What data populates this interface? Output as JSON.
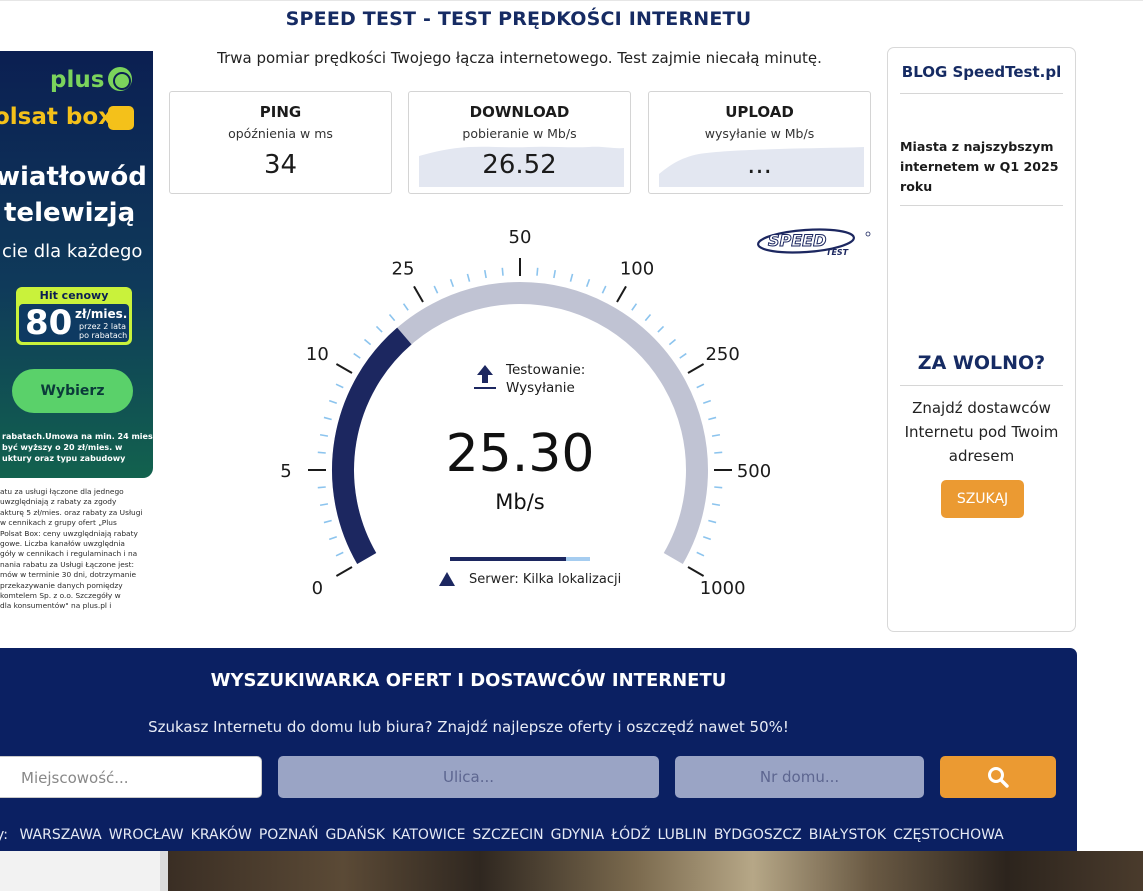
{
  "header": {
    "title": "SPEED TEST - TEST PRĘDKOŚCI INTERNETU"
  },
  "subtitle": "Trwa pomiar prędkości Twojego łącza internetowego. Test zajmie niecałą minutę.",
  "ad": {
    "brand1": "plus",
    "brand2": "olsat box",
    "line1": "wiatłowód",
    "line2": "telewizją",
    "line3": "cie dla każdego",
    "price_tag": "Hit cenowy",
    "price_num": "80",
    "price_unit": "zł/mies.",
    "price_sub1": "przez 2 lata",
    "price_sub2": "po rabatach",
    "cta": "Wybierz",
    "fine1": "rabatach.Umowa na min. 24 mies.",
    "fine2": "być wyższy o 20 zł/mies. w",
    "fine3": "uktury oraz typu zabudowy",
    "legal": [
      "atu za usługi łączone dla jednego",
      "uwzględniają z rabaty za zgody",
      "akturę 5 zł/mies. oraz rabaty za Usługi",
      "w cennikach z grupy ofert „Plus",
      "Polsat Box: ceny uwzględniają rabaty",
      "gowe. Liczba kanałów uwzględnia",
      "góły w cennikach i regulaminach i na",
      "nania rabatu za Usługi Łączone jest:",
      "mów w terminie 30 dni, dotrzymanie",
      "przekazywanie danych pomiędzy",
      "komtelem Sp. z o.o. Szczegóły w",
      "dla konsumentów\" na plus.pl i"
    ]
  },
  "stats": {
    "ping": {
      "title": "PING",
      "sub": "opóźnienia w ms",
      "value": "34"
    },
    "download": {
      "title": "DOWNLOAD",
      "sub": "pobieranie w Mb/s",
      "value": "26.52"
    },
    "upload": {
      "title": "UPLOAD",
      "sub": "wysyłanie w Mb/s",
      "value": "..."
    }
  },
  "gauge": {
    "status_line1": "Testowanie:",
    "status_line2": "Wysyłanie",
    "value": "25.30",
    "unit": "Mb/s",
    "ticks": [
      "0",
      "5",
      "10",
      "25",
      "50",
      "100",
      "250",
      "500",
      "1000"
    ],
    "fraction": 0.33,
    "progress": 0.83,
    "server": "Serwer: Kilka lokalizacji"
  },
  "logo": {
    "top": "SPEED",
    "bottom": "TEST"
  },
  "sidebar": {
    "blog_title": "BLOG SpeedTest.pl",
    "blog_item": "Miasta z najszybszym internetem w Q1 2025 roku",
    "slow_title": "ZA WOLNO?",
    "slow_text": "Znajdź dostawców Internetu pod Twoim adresem",
    "search_label": "SZUKAJ"
  },
  "band": {
    "title": "WYSZUKIWARKA OFERT I DOSTAWCÓW INTERNETU",
    "subtitle": "Szukasz Internetu do domu lub biura? Znajdź najlepsze oferty i oszczędź nawet 50%!",
    "city_placeholder": "Miejscowość...",
    "street_placeholder": "Ulica...",
    "number_placeholder": "Nr domu...",
    "cities_label": "y:",
    "cities": [
      "WARSZAWA",
      "WROCŁAW",
      "KRAKÓW",
      "POZNAŃ",
      "GDAŃSK",
      "KATOWICE",
      "SZCZECIN",
      "GDYNIA",
      "ŁÓDŹ",
      "LUBLIN",
      "BYDGOSZCZ",
      "BIAŁYSTOK",
      "CZĘSTOCHOWA"
    ]
  },
  "colors": {
    "navy": "#162b63",
    "band": "#0b2062",
    "gauge_fill": "#1c2760",
    "gauge_track": "#c0c3d3",
    "minor_tick": "#8cc4ee",
    "orange": "#eb9a32"
  }
}
